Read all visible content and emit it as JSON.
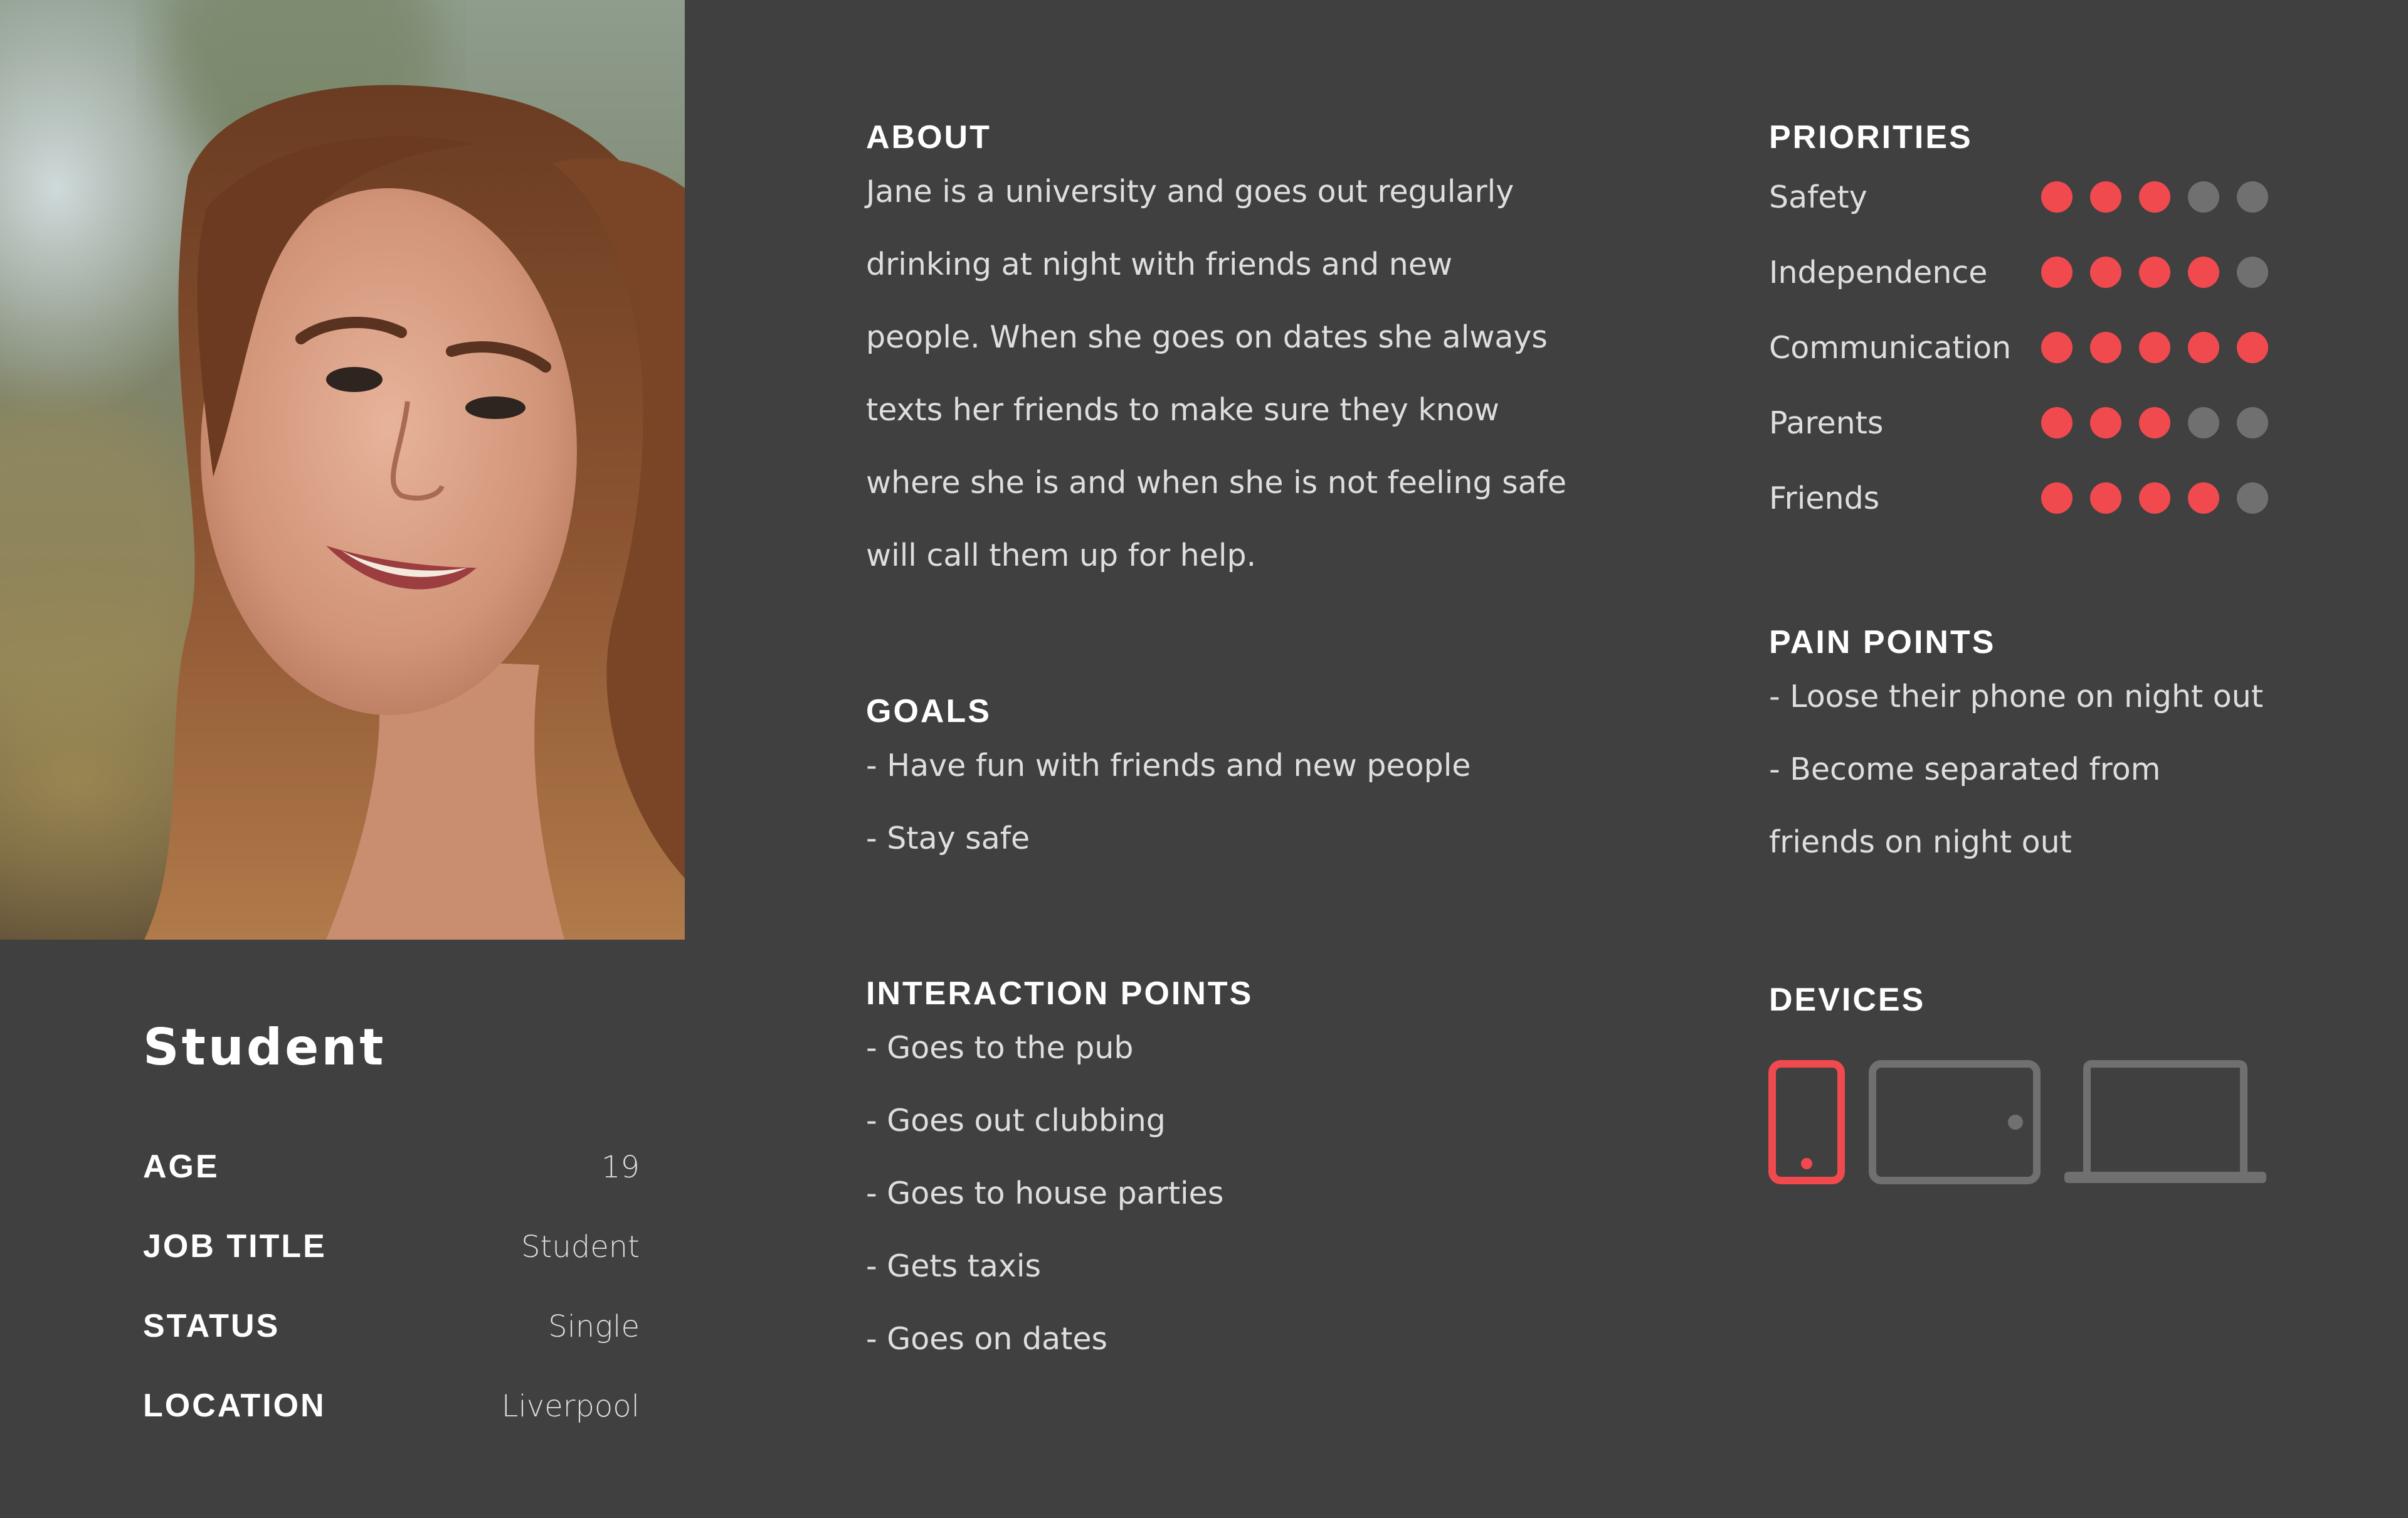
{
  "persona": {
    "title": "Student",
    "facts": [
      {
        "label": "AGE",
        "value": "19"
      },
      {
        "label": "JOB TITLE",
        "value": "Student"
      },
      {
        "label": "STATUS",
        "value": "Single"
      },
      {
        "label": "LOCATION",
        "value": "Liverpool"
      }
    ]
  },
  "about": {
    "heading": "ABOUT",
    "text": "Jane is a university and goes out regularly drinking at night with friends and new people. When she goes on dates she always texts her friends to make sure they know where she is and when she is not feeling safe will call them up for help."
  },
  "goals": {
    "heading": "GOALS",
    "items": [
      "- Have fun with friends and new people",
      "- Stay safe"
    ]
  },
  "interaction_points": {
    "heading": "INTERACTION POINTS",
    "items": [
      "- Goes to the pub",
      "- Goes out clubbing",
      "- Goes to house parties",
      "- Gets taxis",
      "- Goes on dates"
    ]
  },
  "priorities": {
    "heading": "PRIORITIES",
    "max": 5,
    "items": [
      {
        "label": "Safety",
        "rating": 3
      },
      {
        "label": "Independence",
        "rating": 4
      },
      {
        "label": "Communication",
        "rating": 5
      },
      {
        "label": "Parents",
        "rating": 3
      },
      {
        "label": "Friends",
        "rating": 4
      }
    ]
  },
  "pain_points": {
    "heading": "PAIN POINTS",
    "items": [
      "- Loose their phone on night out",
      "- Become separated from",
      "friends on night out"
    ]
  },
  "devices": {
    "heading": "DEVICES",
    "items": [
      {
        "icon": "phone-icon",
        "highlighted": true
      },
      {
        "icon": "tablet-icon",
        "highlighted": false
      },
      {
        "icon": "laptop-icon",
        "highlighted": false
      }
    ]
  },
  "colors": {
    "background": "#404040",
    "accent": "#f04a4f",
    "inactive": "#707070"
  }
}
